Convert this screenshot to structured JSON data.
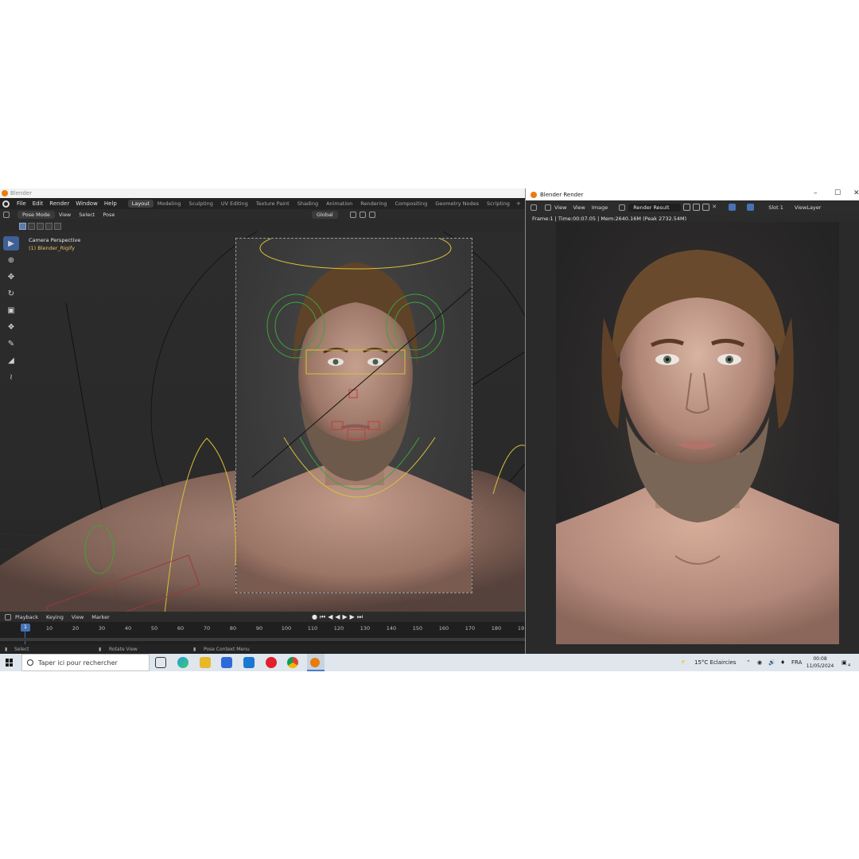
{
  "blender": {
    "title": "Blender",
    "menu": [
      "File",
      "Edit",
      "Render",
      "Window",
      "Help"
    ],
    "workspaces": [
      "Layout",
      "Modeling",
      "Sculpting",
      "UV Editing",
      "Texture Paint",
      "Shading",
      "Animation",
      "Rendering",
      "Compositing",
      "Geometry Nodes",
      "Scripting"
    ],
    "active_workspace": "Layout",
    "header": {
      "mode": "Pose Mode",
      "view": "View",
      "select": "Select",
      "pose": "Pose",
      "orientation": "Global"
    },
    "viewport": {
      "camera_label": "Camera Perspective",
      "object_label": "(1) Blender_Rigify"
    },
    "timeline": {
      "menu": [
        "Playback",
        "Keying",
        "View",
        "Marker"
      ],
      "current_frame": "1",
      "frames": [
        "10",
        "20",
        "30",
        "40",
        "50",
        "60",
        "70",
        "80",
        "90",
        "100",
        "110",
        "120",
        "130",
        "140",
        "150",
        "160",
        "170",
        "180",
        "19"
      ]
    },
    "status": {
      "select": "Select",
      "rotate": "Rotate View",
      "context": "Pose Context Menu"
    }
  },
  "render_window": {
    "title": "Blender Render",
    "menu": [
      "View",
      "View",
      "Image"
    ],
    "image_name": "Render Result",
    "slot": "Slot 1",
    "view_layer": "ViewLayer",
    "info": "Frame:1 | Time:00:07.05 | Mem:2640.16M (Peak 2732.54M)"
  },
  "taskbar": {
    "search_placeholder": "Taper ici pour rechercher",
    "weather": "15°C  Eclaircies",
    "language": "FRA",
    "time": "00:08",
    "date": "11/05/2024",
    "notifications": "4"
  },
  "colors": {
    "blender_orange": "#e87d0d",
    "active_blue": "#4772b3",
    "rig_yellow": "#d9c238",
    "rig_green": "#3fa33a"
  }
}
